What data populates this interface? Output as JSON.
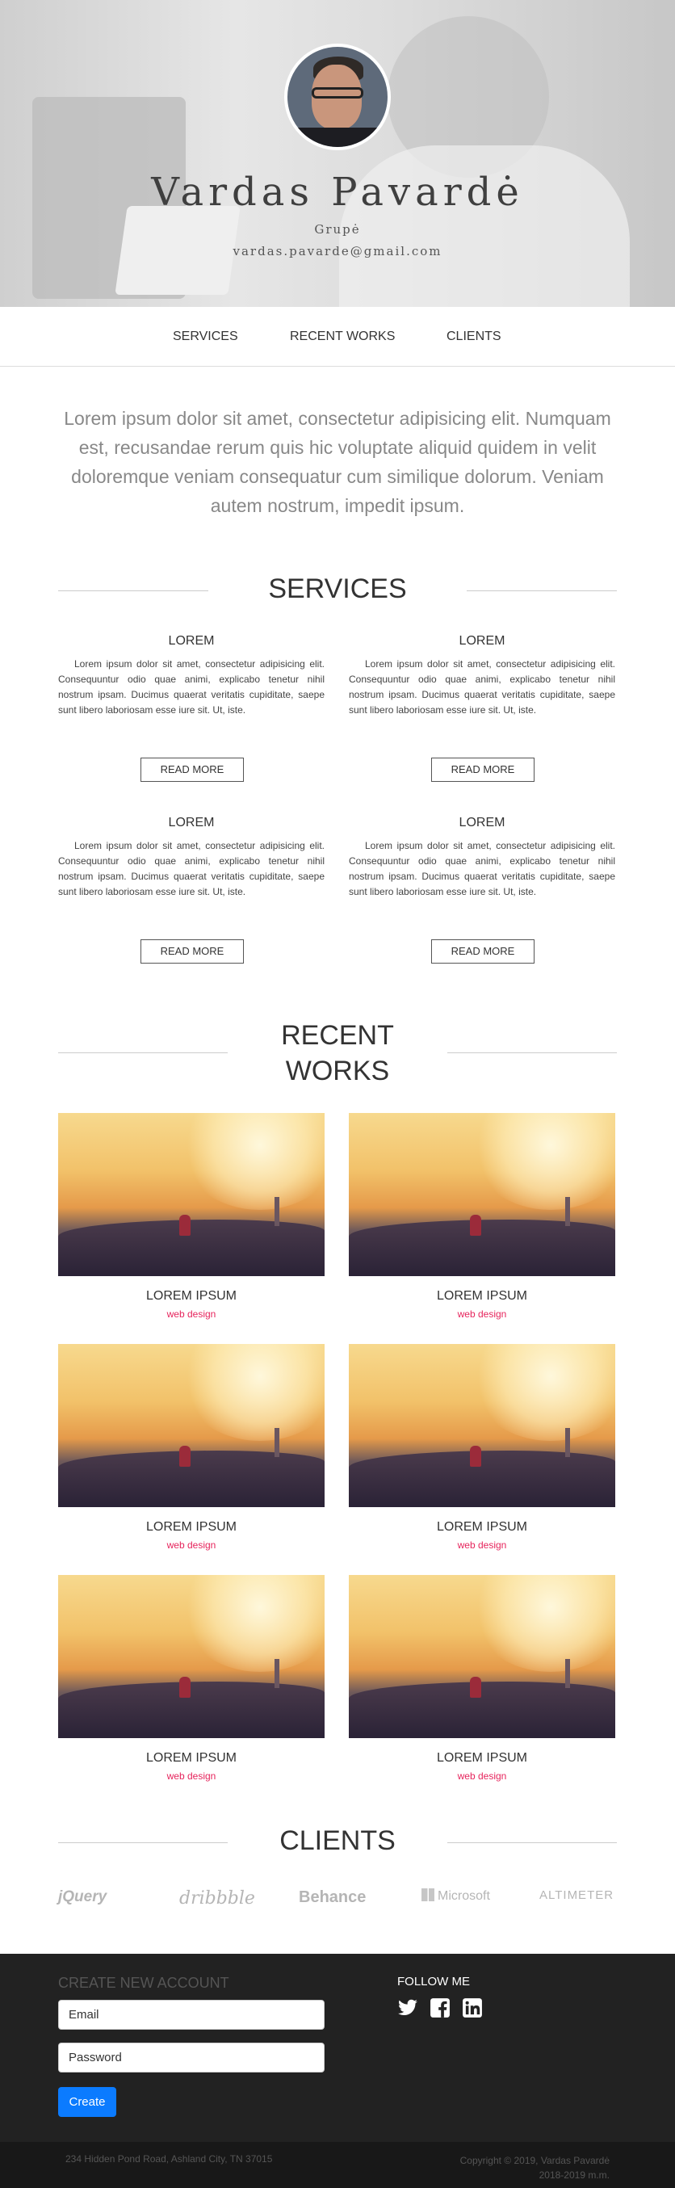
{
  "hero": {
    "name": "Vardas Pavardė",
    "group": "Grupė",
    "email": "vardas.pavarde@gmail.com"
  },
  "nav": {
    "items": [
      {
        "label": "SERVICES"
      },
      {
        "label": "RECENT WORKS"
      },
      {
        "label": "CLIENTS"
      }
    ]
  },
  "intro": "Lorem ipsum dolor sit amet, consectetur adipisicing elit. Numquam est, recusandae rerum quis hic voluptate aliquid quidem in velit doloremque veniam consequatur cum similique dolorum. Veniam autem nostrum, impedit ipsum.",
  "services": {
    "title": "SERVICES",
    "items": [
      {
        "heading": "LOREM",
        "text": "Lorem ipsum dolor sit amet, consectetur adipisicing elit. Consequuntur odio quae animi, explicabo tenetur nihil nostrum ipsam. Ducimus quaerat veritatis cupiditate, saepe sunt libero laboriosam esse iure sit. Ut, iste.",
        "button": "READ MORE"
      },
      {
        "heading": "LOREM",
        "text": "Lorem ipsum dolor sit amet, consectetur adipisicing elit. Consequuntur odio quae animi, explicabo tenetur nihil nostrum ipsam. Ducimus quaerat veritatis cupiditate, saepe sunt libero laboriosam esse iure sit. Ut, iste.",
        "button": "READ MORE"
      },
      {
        "heading": "LOREM",
        "text": "Lorem ipsum dolor sit amet, consectetur adipisicing elit. Consequuntur odio quae animi, explicabo tenetur nihil nostrum ipsam. Ducimus quaerat veritatis cupiditate, saepe sunt libero laboriosam esse iure sit. Ut, iste.",
        "button": "READ MORE"
      },
      {
        "heading": "LOREM",
        "text": "Lorem ipsum dolor sit amet, consectetur adipisicing elit. Consequuntur odio quae animi, explicabo tenetur nihil nostrum ipsam. Ducimus quaerat veritatis cupiditate, saepe sunt libero laboriosam esse iure sit. Ut, iste.",
        "button": "READ MORE"
      }
    ]
  },
  "works": {
    "title_line1": "RECENT",
    "title_line2": "WORKS",
    "items": [
      {
        "title": "LOREM IPSUM",
        "subtitle": "web design"
      },
      {
        "title": "LOREM IPSUM",
        "subtitle": "web design"
      },
      {
        "title": "LOREM IPSUM",
        "subtitle": "web design"
      },
      {
        "title": "LOREM IPSUM",
        "subtitle": "web design"
      },
      {
        "title": "LOREM IPSUM",
        "subtitle": "web design"
      },
      {
        "title": "LOREM IPSUM",
        "subtitle": "web design"
      }
    ]
  },
  "clients": {
    "title": "CLIENTS",
    "logos": [
      "jQuery",
      "dribbble",
      "Behance",
      "Microsoft",
      "ALTIMETER"
    ]
  },
  "footer": {
    "create_account": "CREATE NEW ACCOUNT",
    "email_placeholder": "Email",
    "password_placeholder": "Password",
    "create_button": "Create",
    "follow": "FOLLOW ME",
    "social_icons": [
      "twitter-icon",
      "facebook-icon",
      "linkedin-icon"
    ]
  },
  "bottom": {
    "address": "234 Hidden Pond Road, Ashland City, TN 37015",
    "copyright_line1": "Copyright © 2019, Vardas Pavardė",
    "copyright_line2": "2018-2019 m.m."
  },
  "colors": {
    "accent": "#e6245c",
    "button_blue": "#0b7bff",
    "footer_bg": "#222222"
  }
}
